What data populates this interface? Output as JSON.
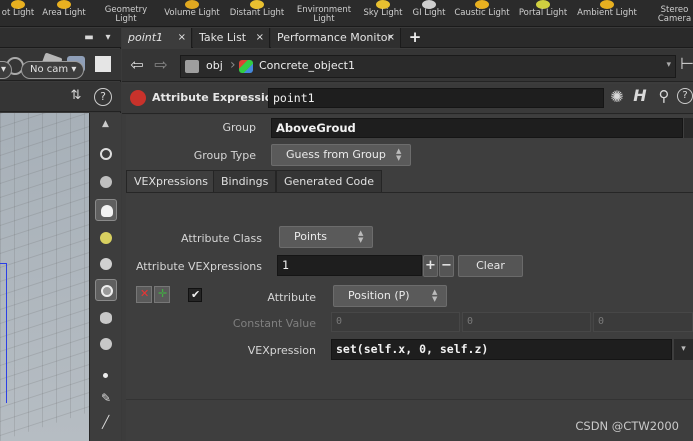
{
  "shelf": {
    "tools": [
      {
        "label": "ot Light",
        "color": "#e8b020"
      },
      {
        "label": "Area Light",
        "color": "#e8b020"
      },
      {
        "label": "Geometry\nLight",
        "color": "#d9a23a"
      },
      {
        "label": "Volume Light",
        "color": "#e0a820"
      },
      {
        "label": "Distant Light",
        "color": "#e8c030"
      },
      {
        "label": "Environment\nLight",
        "color": "#dcdcdc"
      },
      {
        "label": "Sky Light",
        "color": "#e8c030"
      },
      {
        "label": "GI Light",
        "color": "#cfcfcf"
      },
      {
        "label": "Caustic Light",
        "color": "#e8b020"
      },
      {
        "label": "Portal Light",
        "color": "#d0d040"
      },
      {
        "label": "Ambient Light",
        "color": "#e8b020"
      },
      {
        "label": "Stereo\nCamera",
        "color": "#909090"
      }
    ]
  },
  "viewport": {
    "no_cam_label": "No cam",
    "camera_arrow": "▾"
  },
  "tabs": [
    {
      "label": "point1",
      "active": true
    },
    {
      "label": "Take List",
      "active": false
    },
    {
      "label": "Performance Monitor",
      "active": false
    }
  ],
  "tab_close": "×",
  "tab_add": "+",
  "path": {
    "context": "obj",
    "node": "Concrete_object1"
  },
  "node": {
    "type_label": "Attribute Expression",
    "name": "point1"
  },
  "params": {
    "group_label": "Group",
    "group_value": "AboveGroud",
    "group_type_label": "Group Type",
    "group_type_value": "Guess from Group",
    "subtabs": [
      "VEXpressions",
      "Bindings",
      "Generated Code"
    ],
    "attribute_class_label": "Attribute Class",
    "attribute_class_value": "Points",
    "attribute_vexpressions_label": "Attribute VEXpressions",
    "attribute_vexpressions_value": "1",
    "clear_label": "Clear",
    "attribute_label": "Attribute",
    "attribute_value": "Position (P)",
    "constant_value_label": "Constant Value",
    "constant_values": [
      "0",
      "0",
      "0"
    ],
    "vexpression_label": "VEXpression",
    "vexpression_value": "set(self.x, 0, self.z)"
  },
  "watermark": "CSDN @CTW2000",
  "colors": {
    "panel": "#3c3c3c",
    "field": "#1e1e1e",
    "accent_red": "#c8322b",
    "accent_green": "#43b043"
  }
}
